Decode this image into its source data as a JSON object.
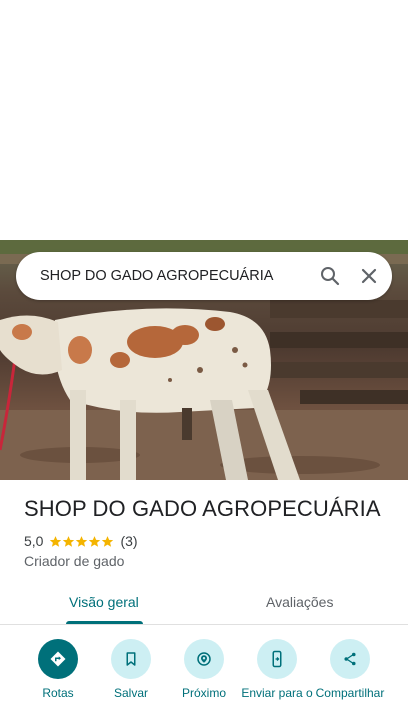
{
  "search": {
    "query": "SHOP DO GADO AGROPECUÁRIA"
  },
  "place": {
    "title": "SHOP DO GADO AGROPECUÁRIA",
    "rating": "5,0",
    "stars_filled": 5,
    "review_count": "(3)",
    "category": "Criador de gado"
  },
  "tabs": {
    "overview": "Visão geral",
    "reviews": "Avaliações"
  },
  "actions": [
    {
      "label": "Rotas",
      "icon": "directions-icon"
    },
    {
      "label": "Salvar",
      "icon": "bookmark-icon"
    },
    {
      "label": "Próximo",
      "icon": "nearby-icon"
    },
    {
      "label": "Enviar para o",
      "icon": "send-to-phone-icon"
    },
    {
      "label": "Compartilhar",
      "icon": "share-icon"
    }
  ],
  "colors": {
    "accent": "#00707a",
    "accent_light": "#cdeff3",
    "star": "#f4b400"
  }
}
